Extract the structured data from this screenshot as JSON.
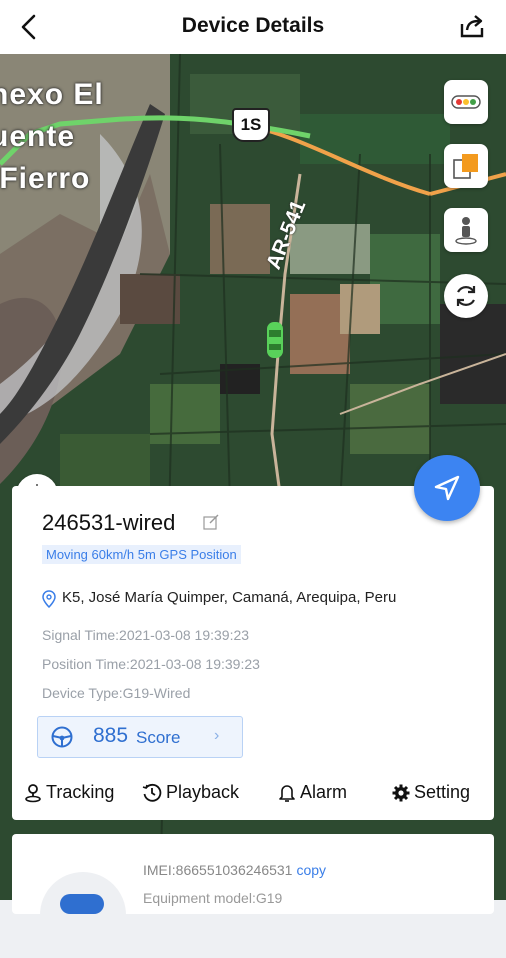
{
  "header": {
    "title": "Device Details"
  },
  "map": {
    "place_label": "nexo El\nuente\n Fierro",
    "route_shield": "1S",
    "road_label": "AR-541"
  },
  "device": {
    "name": "246531-wired",
    "status": "Moving 60km/h 5m GPS Position",
    "address": "K5, José María Quimper, Camaná, Arequipa, Peru",
    "signal_time": "Signal Time:2021-03-08 19:39:23",
    "position_time": "Position Time:2021-03-08 19:39:23",
    "device_type": "Device Type:G19-Wired",
    "score_value": "885",
    "score_label": "Score",
    "score_chevron": "›"
  },
  "actions": [
    {
      "label": "Tracking",
      "icon": "person-pin-icon"
    },
    {
      "label": "Playback",
      "icon": "history-icon"
    },
    {
      "label": "Alarm",
      "icon": "bell-icon"
    },
    {
      "label": "Setting",
      "icon": "gear-icon"
    }
  ],
  "secondary": {
    "imei": "IMEI:866551036246531",
    "copy_label": "copy",
    "equipment_model": "Equipment model:G19"
  },
  "colors": {
    "accent": "#3c84f2",
    "route_green": "#6fd36a",
    "route_orange": "#f0a24a"
  }
}
